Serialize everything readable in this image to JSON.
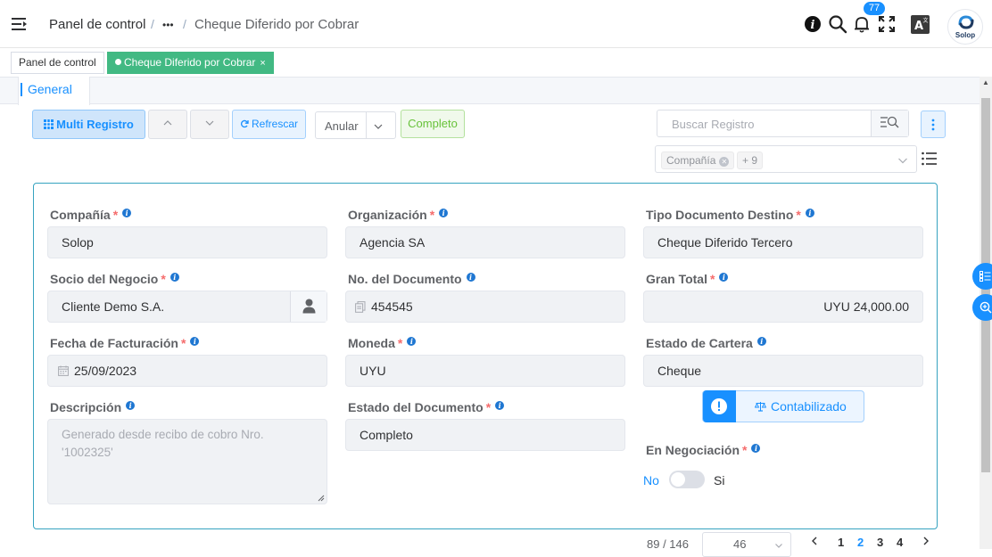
{
  "header": {
    "breadcrumb": {
      "home": "Panel de control",
      "ellipsis": "•••",
      "current": "Cheque Diferido por Cobrar"
    },
    "notifications_count": "77",
    "avatar_label": "Solop"
  },
  "tags": {
    "items": [
      {
        "label": "Panel de control"
      },
      {
        "label": "Cheque Diferido por Cobrar",
        "close": "×"
      }
    ]
  },
  "tabs": [
    {
      "label": "General"
    }
  ],
  "toolbar": {
    "multi_label": "Multi Registro",
    "refresh_label": "Refrescar",
    "action_value": "Anular",
    "doc_action_label": "Completo",
    "search_placeholder": "Buscar Registro"
  },
  "filters": {
    "chips": [
      {
        "label": "Compañía"
      },
      {
        "label": "+ 9"
      }
    ]
  },
  "form": {
    "col1": {
      "compania": {
        "label": "Compañía",
        "value": "Solop"
      },
      "socio": {
        "label": "Socio del Negocio",
        "value": "Cliente Demo S.A."
      },
      "fecha": {
        "label": "Fecha de Facturación",
        "value": "25/09/2023"
      },
      "descripcion": {
        "label": "Descripción",
        "placeholder": "Generado desde recibo de cobro Nro. '1002325'"
      }
    },
    "col2": {
      "organizacion": {
        "label": "Organización",
        "value": "Agencia SA"
      },
      "documento": {
        "label": "No. del Documento",
        "value": "454545"
      },
      "moneda": {
        "label": "Moneda",
        "value": "UYU"
      },
      "estado_doc": {
        "label": "Estado del Documento",
        "value": "Completo"
      }
    },
    "col3": {
      "tipo_doc": {
        "label": "Tipo Documento Destino",
        "value": "Cheque Diferido Tercero"
      },
      "gran_total": {
        "label": "Gran Total",
        "value": "UYU 24,000.00"
      },
      "estado_cartera": {
        "label": "Estado de Cartera",
        "value": "Cheque"
      },
      "doc_status": {
        "label": "Contabilizado"
      },
      "negociacion": {
        "label": "En Negociación",
        "off_label": "No",
        "on_label": "Si",
        "value": false
      }
    },
    "required_mark": "*",
    "info_glyph": "i"
  },
  "pagination": {
    "record": "89 / 146",
    "page_size": "46",
    "pages": [
      "1",
      "2",
      "3",
      "4"
    ],
    "current_page": "2"
  },
  "colors": {
    "primary": "#1890ff",
    "success_tag": "#42b983",
    "panel_border": "#36a3c0"
  }
}
